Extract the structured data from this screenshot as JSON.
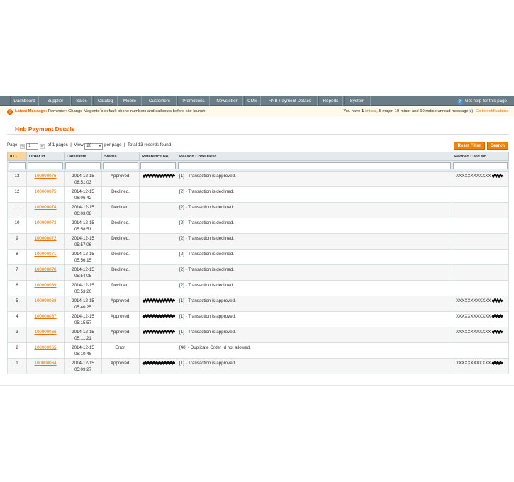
{
  "nav": {
    "items": [
      {
        "label": "Dashboard"
      },
      {
        "label": "Supplier"
      },
      {
        "label": "Sales"
      },
      {
        "label": "Catalog"
      },
      {
        "label": "Mobile"
      },
      {
        "label": "Customers"
      },
      {
        "label": "Promotions"
      },
      {
        "label": "Newsletter"
      },
      {
        "label": "CMS"
      },
      {
        "label": "HNB Payment Details"
      },
      {
        "label": "Reports"
      },
      {
        "label": "System"
      }
    ],
    "help_label": "Get help for this page"
  },
  "notice": {
    "latest_label": "Latest Message:",
    "latest_text": "Reminder: Change Magento`s default phone numbers and callbouts before site launch",
    "summary_prefix": "You have",
    "critical_count": "1",
    "critical_label": "critical",
    "major": "5 major,",
    "minor": "19 minor",
    "and": "and",
    "notice_count": "60 notice unread message(s).",
    "goto_link": "Go to notifications"
  },
  "page_title": "Hnb Payment Details",
  "pager": {
    "page_label": "Page",
    "page_value": "1",
    "of_pages": "of 1 pages",
    "sep1": "|",
    "view_label": "View",
    "per_page_value": "20",
    "per_page_label": "per page",
    "sep2": "|",
    "total": "Total 13 records found"
  },
  "buttons": {
    "reset_filter": "Reset Filter",
    "search": "Search"
  },
  "columns": [
    {
      "label": "ID"
    },
    {
      "label": "Order Id"
    },
    {
      "label": "Date/Time"
    },
    {
      "label": "Status"
    },
    {
      "label": "Reference No"
    },
    {
      "label": "Reason Code Desc"
    },
    {
      "label": "Padded Card No"
    }
  ],
  "sort_icon": "sort-desc-icon",
  "rows": [
    {
      "id": "13",
      "order": "100000076",
      "date": "2014-12-15",
      "time": "08:51:03",
      "status": "Approved.",
      "reason": "[1] - Transaction is approved.",
      "card": "XXXXXXXXXXXX",
      "redacted": true
    },
    {
      "id": "12",
      "order": "100000075",
      "date": "2014-12-15",
      "time": "06:06:42",
      "status": "Declined.",
      "reason": "[2] - Transaction is declined.",
      "card": "",
      "redacted": false
    },
    {
      "id": "11",
      "order": "100000074",
      "date": "2014-12-15",
      "time": "06:03:08",
      "status": "Declined.",
      "reason": "[2] - Transaction is declined.",
      "card": "",
      "redacted": false
    },
    {
      "id": "10",
      "order": "100000073",
      "date": "2014-12-15",
      "time": "05:58:51",
      "status": "Declined.",
      "reason": "[2] - Transaction is declined.",
      "card": "",
      "redacted": false
    },
    {
      "id": "9",
      "order": "100000072",
      "date": "2014-12-15",
      "time": "05:57:06",
      "status": "Declined.",
      "reason": "[2] - Transaction is declined.",
      "card": "",
      "redacted": false
    },
    {
      "id": "8",
      "order": "100000071",
      "date": "2014-12-15",
      "time": "05:56:15",
      "status": "Declined.",
      "reason": "[2] - Transaction is declined.",
      "card": "",
      "redacted": false
    },
    {
      "id": "7",
      "order": "100000070",
      "date": "2014-12-15",
      "time": "05:54:05",
      "status": "Declined.",
      "reason": "[2] - Transaction is declined.",
      "card": "",
      "redacted": false
    },
    {
      "id": "6",
      "order": "100000069",
      "date": "2014-12-15",
      "time": "05:53:20",
      "status": "Declined.",
      "reason": "[2] - Transaction is declined.",
      "card": "",
      "redacted": false
    },
    {
      "id": "5",
      "order": "100000068",
      "date": "2014-12-15",
      "time": "05:40:25",
      "status": "Approved.",
      "reason": "[1] - Transaction is approved.",
      "card": "XXXXXXXXXXXX",
      "redacted": true
    },
    {
      "id": "4",
      "order": "100000067",
      "date": "2014-12-15",
      "time": "05:15:57",
      "status": "Approved.",
      "reason": "[1] - Transaction is approved.",
      "card": "XXXXXXXXXXXX",
      "redacted": true
    },
    {
      "id": "3",
      "order": "100000066",
      "date": "2014-12-15",
      "time": "05:11:21",
      "status": "Approved.",
      "reason": "[1] - Transaction is approved.",
      "card": "XXXXXXXXXXXX",
      "redacted": true
    },
    {
      "id": "2",
      "order": "100000065",
      "date": "2014-12-15",
      "time": "05:10:48",
      "status": "Error.",
      "reason": "[40] - Duplicate Order Id not allowed.",
      "card": "",
      "redacted": false
    },
    {
      "id": "1",
      "order": "100000064",
      "date": "2014-12-15",
      "time": "05:09:27",
      "status": "Approved.",
      "reason": "[1] - Transaction is approved.",
      "card": "XXXXXXXXXXXX",
      "redacted": true
    }
  ],
  "colors": {
    "accent": "#eb5e00",
    "nav_bg": "#6a7c86",
    "button": "#f18200"
  }
}
